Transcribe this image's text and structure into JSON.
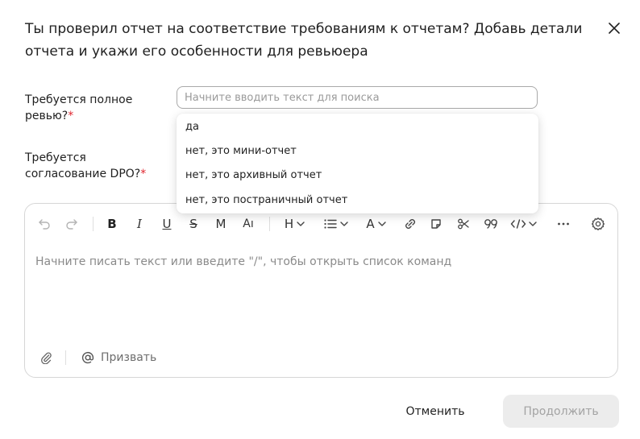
{
  "dialog": {
    "title": "Ты проверил отчет на соответствие требованиям к отчетам? Добавь детали отчета и укажи его особенности для ревьюера"
  },
  "fields": {
    "full_review": {
      "label": "Требуется полное ревью?",
      "required_mark": "*",
      "search_placeholder": "Начните вводить текст для поиска",
      "options": [
        "да",
        "нет, это мини-отчет",
        "нет, это архивный отчет",
        "нет, это постраничный отчет"
      ]
    },
    "dpo_approval": {
      "label": "Требуется согласование DPO?",
      "required_mark": "*"
    }
  },
  "editor": {
    "placeholder": "Начните писать текст или введите \"/\", чтобы открыть список команд",
    "toolbar_icons": [
      "undo-icon",
      "redo-icon",
      "bold-icon",
      "italic-icon",
      "underline-icon",
      "strikethrough-icon",
      "monospace-icon",
      "clear-format-icon",
      "heading-icon",
      "list-icon",
      "text-color-icon",
      "link-icon",
      "note-icon",
      "cut-icon",
      "quote-icon",
      "code-icon",
      "more-icon",
      "settings-icon"
    ],
    "mention_label": "Призвать"
  },
  "footer": {
    "cancel_label": "Отменить",
    "continue_label": "Продолжить"
  },
  "colors": {
    "required": "#e0252e",
    "disabled_button_bg": "#ececec",
    "disabled_button_text": "#a3a3a3"
  }
}
